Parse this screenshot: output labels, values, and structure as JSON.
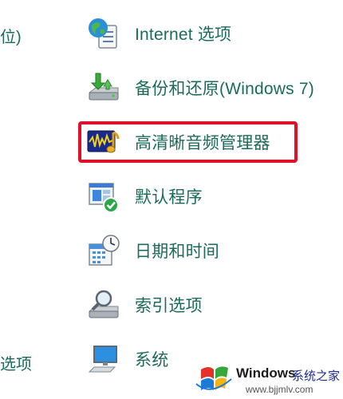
{
  "left_column": {
    "top_text": "位)",
    "bottom_text": "选项"
  },
  "items": [
    {
      "label": "Internet 选项",
      "icon": "globe-document-icon"
    },
    {
      "label": "备份和还原(Windows 7)",
      "icon": "backup-drive-icon"
    },
    {
      "label": "高清晰音频管理器",
      "icon": "audio-manager-icon"
    },
    {
      "label": "默认程序",
      "icon": "default-programs-icon"
    },
    {
      "label": "日期和时间",
      "icon": "calendar-clock-icon"
    },
    {
      "label": "索引选项",
      "icon": "indexing-magnifier-icon"
    },
    {
      "label": "系统",
      "icon": "computer-system-icon"
    }
  ],
  "highlight_color": "#e0102a",
  "label_color": "#1a6b5c",
  "watermark": {
    "title": "Windows",
    "subtitle": "系统之家",
    "url": "www.bjjmlv.com"
  }
}
